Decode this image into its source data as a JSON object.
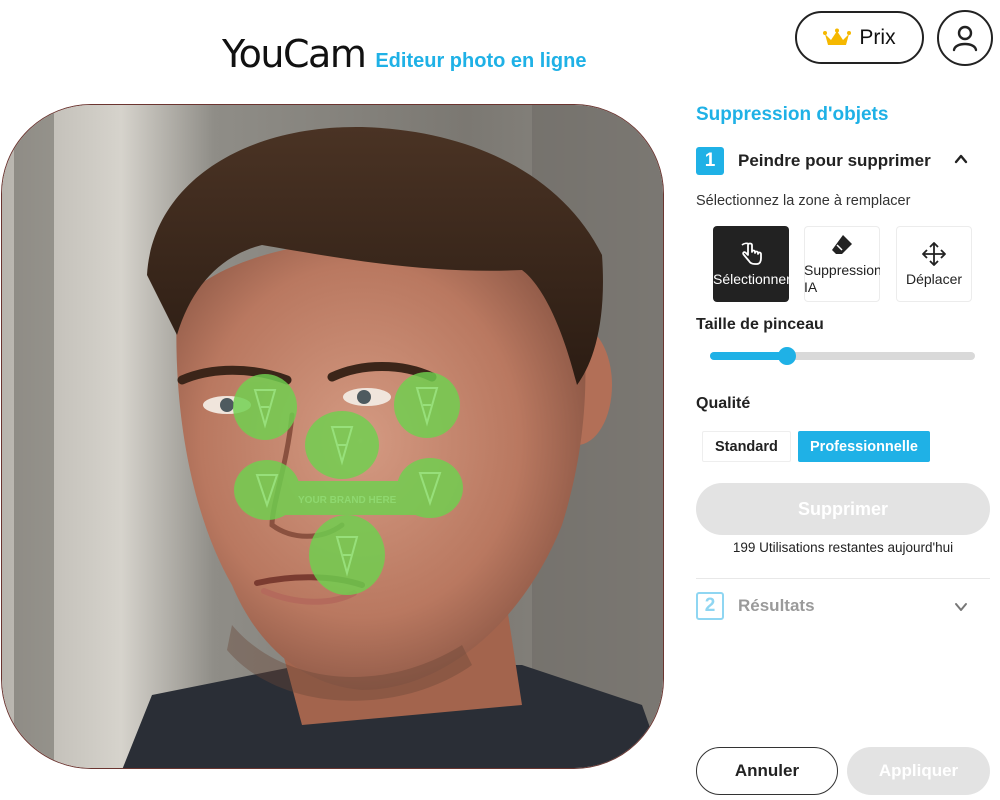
{
  "header": {
    "brand": "YouCam",
    "subtitle": "Editeur photo en ligne",
    "prix_label": "Prix",
    "prix_icon": "crown-icon",
    "account_icon": "user-icon"
  },
  "canvas": {
    "watermark_text": "YOUR BRAND HERE",
    "mask_color": "#6fd14f"
  },
  "panel": {
    "title": "Suppression d'objets",
    "step1": {
      "number": "1",
      "label": "Peindre pour supprimer",
      "expanded": true
    },
    "hint": "Sélectionnez la zone à remplacer",
    "tools": [
      {
        "label": "Sélectionner",
        "icon": "hand-pointer-icon",
        "selected": true
      },
      {
        "label": "Suppression IA",
        "icon": "eraser-icon",
        "selected": false
      },
      {
        "label": "Déplacer",
        "icon": "move-icon",
        "selected": false
      }
    ],
    "brush": {
      "label": "Taille de pinceau",
      "level": 0.29
    },
    "quality": {
      "label": "Qualité",
      "options": [
        "Standard",
        "Professionnelle"
      ],
      "selected": "Professionnelle"
    },
    "remove_button": "Supprimer",
    "remaining_uses": "199 Utilisations restantes aujourd'hui",
    "step2": {
      "number": "2",
      "label": "Résultats",
      "expanded": false
    }
  },
  "footer": {
    "cancel": "Annuler",
    "apply": "Appliquer"
  },
  "colors": {
    "accent": "#1fb1e6",
    "dark": "#222222",
    "disabled": "#e3e3e3"
  }
}
